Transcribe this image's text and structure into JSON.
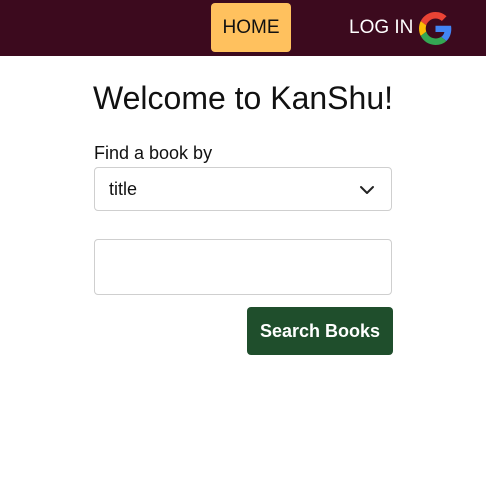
{
  "nav": {
    "home_label": "HOME",
    "login_label": "LOG IN",
    "login_icon": "google-g-icon"
  },
  "main": {
    "title": "Welcome to KanShu!",
    "find_label": "Find a book by",
    "search_by": {
      "selected": "title",
      "icon": "chevron-down-icon"
    },
    "query": {
      "value": "",
      "placeholder": ""
    },
    "search_button_label": "Search Books"
  },
  "colors": {
    "navbar_bg": "#3c0a1e",
    "home_bg": "#ffc15e",
    "search_button_bg": "#1f4e2c"
  }
}
